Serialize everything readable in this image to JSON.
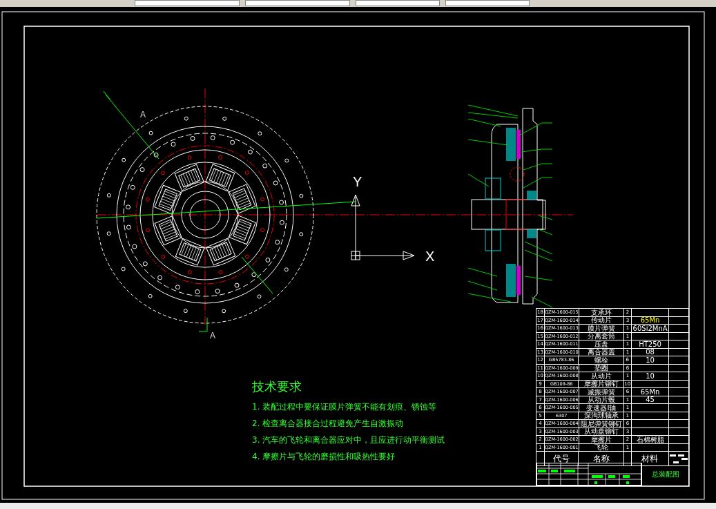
{
  "drawing": {
    "section_labels": [
      "A",
      "A"
    ],
    "axis_labels": {
      "y": "Y",
      "x": "X"
    }
  },
  "tech_requirements": {
    "title": "技术要求",
    "items": [
      "1. 装配过程中要保证膜片弹簧不能有划痕、锈蚀等",
      "2. 检查离合器接合过程避免产生自激振动",
      "3. 汽车的飞轮和离合器应对中，且应进行动平衡测试",
      "4. 摩擦片与飞轮的磨损性和吸热性要好"
    ]
  },
  "parts_list": {
    "header": {
      "code": "代号",
      "name": "名称",
      "material": "材料"
    },
    "rows": [
      {
        "no": "18",
        "code": "QZM-1600-015",
        "name": "支承环",
        "qty": "2",
        "material": ""
      },
      {
        "no": "17",
        "code": "QZM-1600-014",
        "name": "传动片",
        "qty": "3",
        "material": "65Mn",
        "color": "#ffff00"
      },
      {
        "no": "16",
        "code": "QZM-1600-013",
        "name": "膜片弹簧",
        "qty": "1",
        "material": "60Si2MnA"
      },
      {
        "no": "15",
        "code": "QZM-1600-012",
        "name": "分离套筒",
        "qty": "1",
        "material": ""
      },
      {
        "no": "14",
        "code": "QZM-1600-011",
        "name": "压盘",
        "qty": "1",
        "material": "HT250"
      },
      {
        "no": "13",
        "code": "QZM-1600-010",
        "name": "离合器盖",
        "qty": "1",
        "material": "08"
      },
      {
        "no": "12",
        "code": "GB5783-86",
        "name": "螺栓",
        "qty": "6",
        "material": "10"
      },
      {
        "no": "11",
        "code": "QZM-1600-009",
        "name": "垫圈",
        "qty": "6",
        "material": ""
      },
      {
        "no": "10",
        "code": "QZM-1600-008",
        "name": "从动片",
        "qty": "1",
        "material": "10"
      },
      {
        "no": "9",
        "code": "GB109-86",
        "name": "摩擦片铆钉",
        "qty": "10",
        "material": ""
      },
      {
        "no": "8",
        "code": "QZM-1600-007",
        "name": "减振弹簧",
        "qty": "6",
        "material": "65Mn"
      },
      {
        "no": "7",
        "code": "QZM-1600-006",
        "name": "从动片毂",
        "qty": "1",
        "material": "45"
      },
      {
        "no": "6",
        "code": "QZM-1600-005",
        "name": "变速器I轴",
        "qty": "1",
        "material": ""
      },
      {
        "no": "5",
        "code": "6307",
        "name": "深沟球轴承",
        "qty": "1",
        "material": ""
      },
      {
        "no": "4",
        "code": "QZM-1600-004",
        "name": "阻尼弹簧铆钉",
        "qty": "6",
        "material": ""
      },
      {
        "no": "3",
        "code": "QZM-1600-003",
        "name": "从动盘铆钉",
        "qty": "3",
        "material": ""
      },
      {
        "no": "2",
        "code": "QZM-1600-002",
        "name": "摩擦片",
        "qty": "2",
        "material": "石棉树脂"
      },
      {
        "no": "1",
        "code": "QZM-1600-001",
        "name": "飞轮",
        "qty": "1",
        "material": ""
      }
    ]
  },
  "title_block": {
    "title": "总装配图"
  }
}
